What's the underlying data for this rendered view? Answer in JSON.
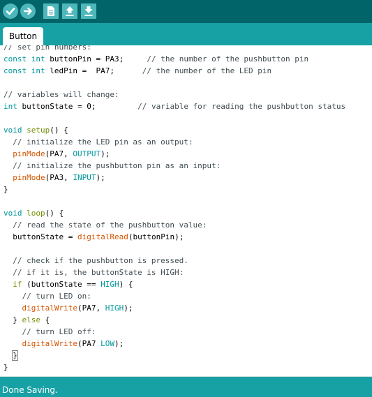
{
  "toolbar": {
    "buttons": [
      {
        "name": "verify",
        "icon": "checkmark-icon"
      },
      {
        "name": "upload",
        "icon": "right-arrow-icon"
      },
      {
        "name": "new",
        "icon": "document-icon"
      },
      {
        "name": "open",
        "icon": "up-arrow-icon"
      },
      {
        "name": "save",
        "icon": "down-arrow-icon"
      }
    ]
  },
  "tabs": [
    {
      "label": "Button",
      "active": true
    }
  ],
  "code_lines": [
    "// set pin numbers:",
    "const int buttonPin = PA3;     // the number of the pushbutton pin",
    "const int ledPin =  PA7;      // the number of the LED pin",
    "",
    "// variables will change:",
    "int buttonState = 0;         // variable for reading the pushbutton status",
    "",
    "void setup() {",
    "  // initialize the LED pin as an output:",
    "  pinMode(PA7, OUTPUT);",
    "  // initialize the pushbutton pin as an input:",
    "  pinMode(PA3, INPUT);",
    "}",
    "",
    "void loop() {",
    "  // read the state of the pushbutton value:",
    "  buttonState = digitalRead(buttonPin);",
    "",
    "  // check if the pushbutton is pressed.",
    "  // if it is, the buttonState is HIGH:",
    "  if (buttonState == HIGH) {",
    "    // turn LED on:",
    "    digitalWrite(PA7, HIGH);",
    "  } else {",
    "    // turn LED off:",
    "    digitalWrite(PA7 LOW);",
    "  }",
    "}"
  ],
  "status": {
    "message": "Done Saving."
  },
  "colors": {
    "toolbar": "#006468",
    "tabbar": "#17a1a5",
    "statusbar": "#17a1a5",
    "button": "#4db7bb",
    "type_keyword": "#00979c",
    "control_keyword": "#728e00",
    "function": "#d35400",
    "comment": "#434f54"
  }
}
